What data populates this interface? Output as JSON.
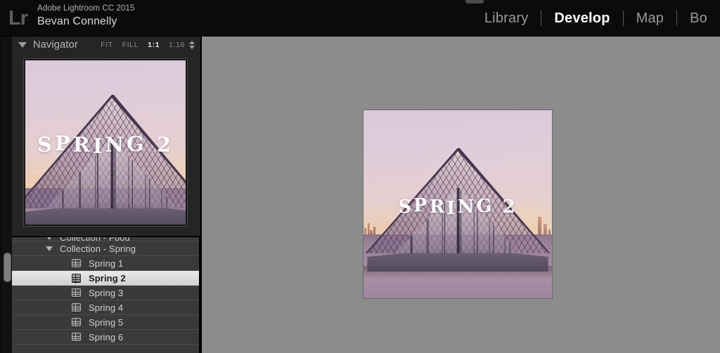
{
  "app": {
    "logo": "Lr",
    "product": "Adobe Lightroom CC 2015",
    "user": "Bevan Connelly"
  },
  "modules": [
    {
      "label": "Library",
      "active": false
    },
    {
      "label": "Develop",
      "active": true
    },
    {
      "label": "Map",
      "active": false
    },
    {
      "label": "Bo",
      "active": false
    }
  ],
  "navigator": {
    "title": "Navigator",
    "zoom_levels": [
      {
        "label": "FIT",
        "active": false
      },
      {
        "label": "FILL",
        "active": false
      },
      {
        "label": "1:1",
        "active": true
      },
      {
        "label": "1:16",
        "active": false
      }
    ],
    "stepper_icon": "up-down-chevron-icon",
    "collapse_icon": "triangle-down-icon",
    "preview_caption": "SPRING 2"
  },
  "collections": {
    "clipped_group": "Collection - Food",
    "group_label": "Collection - Spring",
    "group_icon": "triangle-down-icon",
    "items": [
      {
        "label": "Spring 1",
        "icon": "collection-icon",
        "selected": false
      },
      {
        "label": "Spring 2",
        "icon": "collection-icon",
        "selected": true
      },
      {
        "label": "Spring 3",
        "icon": "collection-icon",
        "selected": false
      },
      {
        "label": "Spring 4",
        "icon": "collection-icon",
        "selected": false
      },
      {
        "label": "Spring 5",
        "icon": "collection-icon",
        "selected": false
      },
      {
        "label": "Spring 6",
        "icon": "collection-icon",
        "selected": false
      }
    ]
  },
  "canvas": {
    "photo_caption": "SPRING 2",
    "background_color": "#8c8c8c"
  },
  "colors": {
    "topbar": "#0b0b0b",
    "panel": "#333333",
    "navigator_panel": "#252525",
    "list_background": "#3a3a3a",
    "selection": "#e8e8e8",
    "active_text": "#ffffff",
    "canvas": "#8c8c8c"
  }
}
